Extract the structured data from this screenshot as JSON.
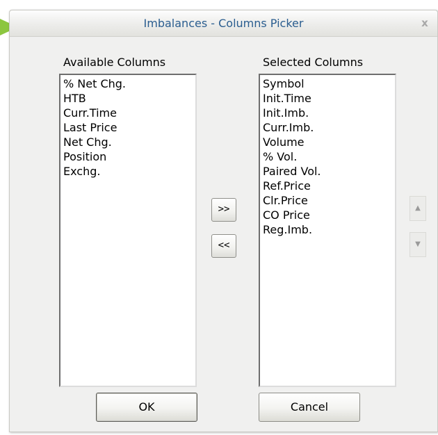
{
  "dialog": {
    "title": "Imbalances - Columns Picker",
    "close_glyph": "x"
  },
  "available": {
    "label": "Available Columns",
    "items": [
      "% Net Chg.",
      "HTB",
      "Curr.Time",
      "Last Price",
      "Net Chg.",
      "Position",
      "Exchg."
    ]
  },
  "selected": {
    "label": "Selected Columns",
    "items": [
      "Symbol",
      "Init.Time",
      "Init.Imb.",
      "Curr.Imb.",
      "Volume",
      "% Vol.",
      "Paired Vol.",
      "Ref.Price",
      "Clr.Price",
      "CO Price",
      "Reg.Imb."
    ]
  },
  "buttons": {
    "add": ">>",
    "remove": "<<",
    "move_up": "▲",
    "move_down": "▼",
    "ok": "OK",
    "cancel": "Cancel"
  },
  "colors": {
    "pointer": "#8cc63f",
    "title_text": "#2a5d8f",
    "dialog_bg": "#f0f0ef"
  },
  "icons": {
    "pointer": "pointer-arrow-icon",
    "close": "close-icon",
    "move_up": "triangle-up-icon",
    "move_down": "triangle-down-icon"
  }
}
